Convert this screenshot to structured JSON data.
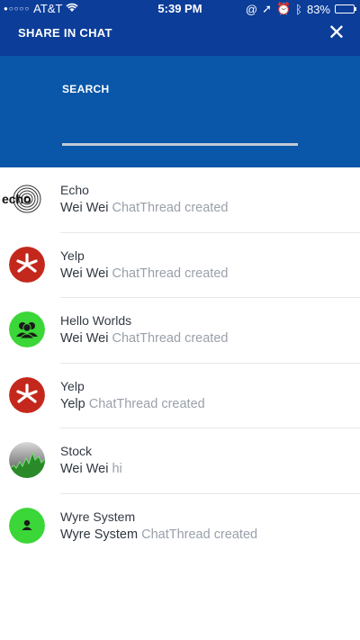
{
  "status_bar": {
    "carrier": "AT&T",
    "time": "5:39 PM",
    "battery": "83%",
    "battery_level": 0.83
  },
  "header": {
    "title": "SHARE IN CHAT",
    "close_icon": "close-icon"
  },
  "search": {
    "label": "SEARCH",
    "value": "",
    "placeholder": ""
  },
  "chats": [
    {
      "name": "Echo",
      "sender": "Wei Wei",
      "message": "ChatThread created",
      "avatar": "echo-logo"
    },
    {
      "name": "Yelp",
      "sender": "Wei Wei",
      "message": "ChatThread created",
      "avatar": "yelp-logo"
    },
    {
      "name": "Hello Worlds",
      "sender": "Wei Wei",
      "message": "ChatThread created",
      "avatar": "group-icon"
    },
    {
      "name": "Yelp",
      "sender": "Yelp",
      "message": "ChatThread created",
      "avatar": "yelp-logo"
    },
    {
      "name": "Stock",
      "sender": "Wei Wei",
      "message": "hi",
      "avatar": "stock-chart-icon"
    },
    {
      "name": "Wyre System",
      "sender": "Wyre System",
      "message": "ChatThread created",
      "avatar": "person-icon"
    }
  ],
  "colors": {
    "header_bg": "#0c3d99",
    "search_bg": "#0a56a8",
    "green_avatar": "#3bd637",
    "yelp_red": "#c4281c"
  }
}
